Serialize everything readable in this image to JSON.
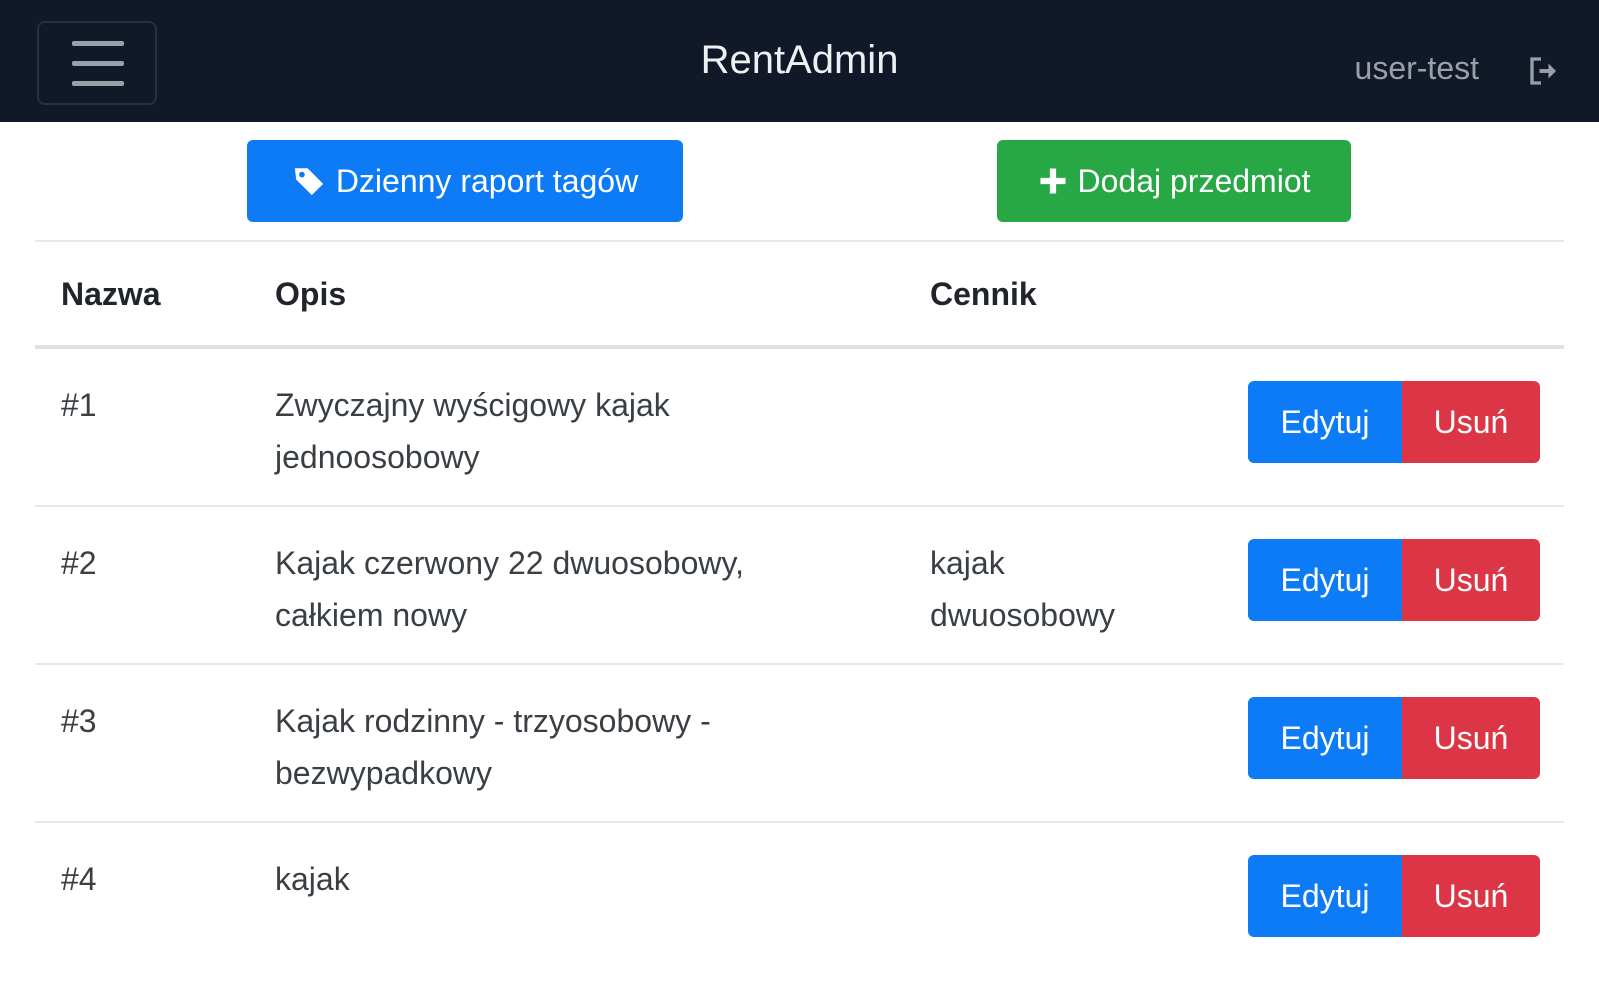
{
  "navbar": {
    "brand": "RentAdmin",
    "user": "user-test",
    "menu_icon": "hamburger-menu-icon",
    "logout_icon": "logout-icon",
    "background": "#111827"
  },
  "toolbar": {
    "report_label": "Dzienny raport tagów",
    "report_icon": "tag-icon",
    "add_label": "Dodaj przedmiot",
    "add_icon": "plus-icon",
    "report_color": "#0d7bf5",
    "add_color": "#28a745"
  },
  "table": {
    "headers": [
      "Nazwa",
      "Opis",
      "Cennik"
    ],
    "edit_label": "Edytuj",
    "delete_label": "Usuń",
    "edit_color": "#0d7bf5",
    "delete_color": "#dc3545",
    "rows": [
      {
        "name": "#1",
        "desc_lines": [
          "Zwyczajny wyścigowy kajak",
          "jednoosobowy"
        ],
        "price_lines": [
          "",
          ""
        ]
      },
      {
        "name": "#2",
        "desc_lines": [
          "Kajak czerwony 22 dwuosobowy,",
          "całkiem nowy"
        ],
        "price_lines": [
          "kajak",
          "dwuosobowy"
        ]
      },
      {
        "name": "#3",
        "desc_lines": [
          "Kajak rodzinny - trzyosobowy -",
          "bezwypadkowy"
        ],
        "price_lines": [
          "",
          ""
        ]
      },
      {
        "name": "#4",
        "desc_lines": [
          "kajak",
          ""
        ],
        "price_lines": [
          "",
          ""
        ]
      }
    ]
  }
}
